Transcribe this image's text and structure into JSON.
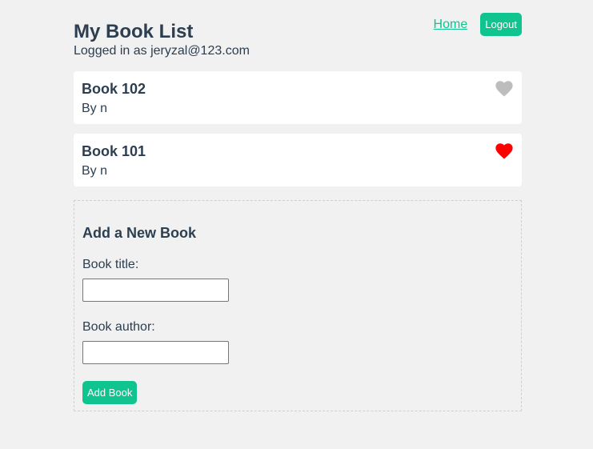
{
  "header": {
    "title": "My Book List",
    "logged_in_text": "Logged in as jeryzal@123.com",
    "nav_home": "Home",
    "logout_label": "Logout"
  },
  "books": [
    {
      "title": "Book 102",
      "author": "By n",
      "favorite": false,
      "icon": "heart-icon"
    },
    {
      "title": "Book 101",
      "author": "By n",
      "favorite": true,
      "icon": "heart-icon"
    }
  ],
  "form": {
    "heading": "Add a New Book",
    "title_label": "Book title:",
    "title_value": "",
    "author_label": "Book author:",
    "author_value": "",
    "submit_label": "Add Book"
  },
  "colors": {
    "accent": "#10c48f",
    "heart_active": "#ff0000",
    "heart_inactive": "#bdbdbd",
    "text": "#2c3e50",
    "background": "#f1f1f1"
  }
}
